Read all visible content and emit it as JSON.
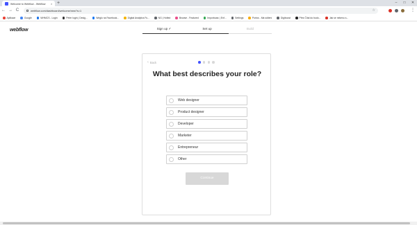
{
  "browser": {
    "tab_title": "Welcome to Webflow - Webflow",
    "tab_close": "×",
    "new_tab": "+",
    "win_min": "–",
    "win_max": "□",
    "win_close": "✕",
    "back": "←",
    "forward": "→",
    "reload": "C",
    "url": "webflow.com/dashboard/welcome/new?s=1",
    "star": "☆",
    "menu": "⋮",
    "accent": "#4353ff"
  },
  "bookmarks": [
    {
      "label": "Aplikace",
      "color": "#e94235"
    },
    {
      "label": "Google",
      "color": "#4285f4"
    },
    {
      "label": "WHMCS - Login",
      "color": "#1a73e8"
    },
    {
      "label": "Peter login | Desig...",
      "color": "#333333"
    },
    {
      "label": "Weglo na Facebook...",
      "color": "#1877f2"
    },
    {
      "label": "Digital Analytics Fu...",
      "color": "#f4b400"
    },
    {
      "label": "NG | Hofied",
      "color": "#5f6368"
    },
    {
      "label": "Browse - Featured",
      "color": "#ea4c89"
    },
    {
      "label": "Importovac | Enf...",
      "color": "#34a853"
    },
    {
      "label": "Settings",
      "color": "#5f6368"
    },
    {
      "label": "Portos - Má sdílení",
      "color": "#f9ab00"
    },
    {
      "label": "Digiboost",
      "color": "#5f6368"
    },
    {
      "label": "Přes Čítal do budo...",
      "color": "#222222"
    },
    {
      "label": "Jak se nekenu s...",
      "color": "#d93025"
    }
  ],
  "webflow": {
    "logo": "webflow",
    "steps": [
      {
        "label": "Sign up",
        "state": "done",
        "check": "✓"
      },
      {
        "label": "Set up",
        "state": "active",
        "check": ""
      },
      {
        "label": "Build",
        "state": "upcoming",
        "check": ""
      }
    ],
    "back_arrow": "‹",
    "back_label": "Back",
    "progress_total": 4,
    "progress_current": 1,
    "heading": "What best describes your role?",
    "options": [
      "Web designer",
      "Product designer",
      "Developer",
      "Marketer",
      "Entrepreneur",
      "Other"
    ],
    "continue_label": "Continue"
  }
}
